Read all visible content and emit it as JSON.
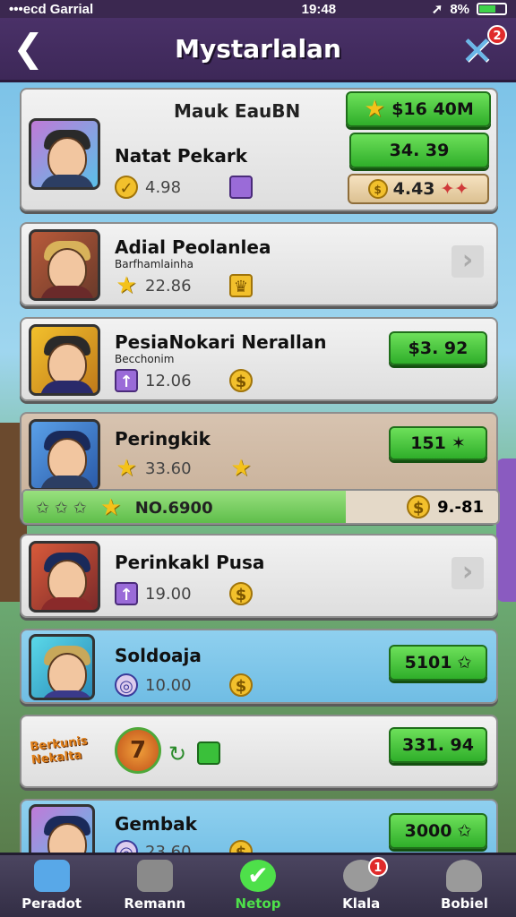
{
  "status": {
    "carrier": "•••ecd Garrial",
    "time": "19:48",
    "battery": "8%",
    "battery_level": 0.6
  },
  "header": {
    "title": "Mystarlalan",
    "back_glyph": "❮",
    "tools_badge": "2"
  },
  "featured": {
    "heading": "Mauk EauBN",
    "name": "Natat Pekark",
    "stat": "4.98",
    "btn_top": "$16 40M",
    "btn_mid": "34. 39",
    "btn_bottom": "4.43"
  },
  "rows": [
    {
      "name": "Adial Peolanlea",
      "sub": "Barfhamlainha",
      "stat": "22.86"
    },
    {
      "name": "PesiaNokari Nerallan",
      "sub": "Becchonim",
      "stat": "12.06",
      "btn": "$3. 92"
    },
    {
      "name": "Peringkik",
      "stat": "33.60",
      "btn": "151",
      "progress_label": "NO.6900",
      "progress_value": "9.-81",
      "progress_fraction": 0.68
    },
    {
      "name": "Perinkakl Pusa",
      "stat": "19.00"
    },
    {
      "name": "Soldoaja",
      "stat": "10.00",
      "btn": "5101"
    },
    {
      "logo_text": "Berkunis Nekalta",
      "btn": "331. 94"
    },
    {
      "name": "Gembak",
      "stat": "23.60",
      "btn": "3000"
    }
  ],
  "nav": [
    {
      "label": "Peradot",
      "icon": "home-icon",
      "color": "#58a8e8"
    },
    {
      "label": "Remann",
      "icon": "house-icon",
      "color": "#8a8a8a"
    },
    {
      "label": "Netop",
      "icon": "check-icon",
      "active": true,
      "color": "#4ee04a"
    },
    {
      "label": "Klala",
      "icon": "timer-icon",
      "badge": "1",
      "color": "#9a9a9a"
    },
    {
      "label": "Bobiel",
      "icon": "profile-icon",
      "color": "#9a9a9a"
    }
  ]
}
